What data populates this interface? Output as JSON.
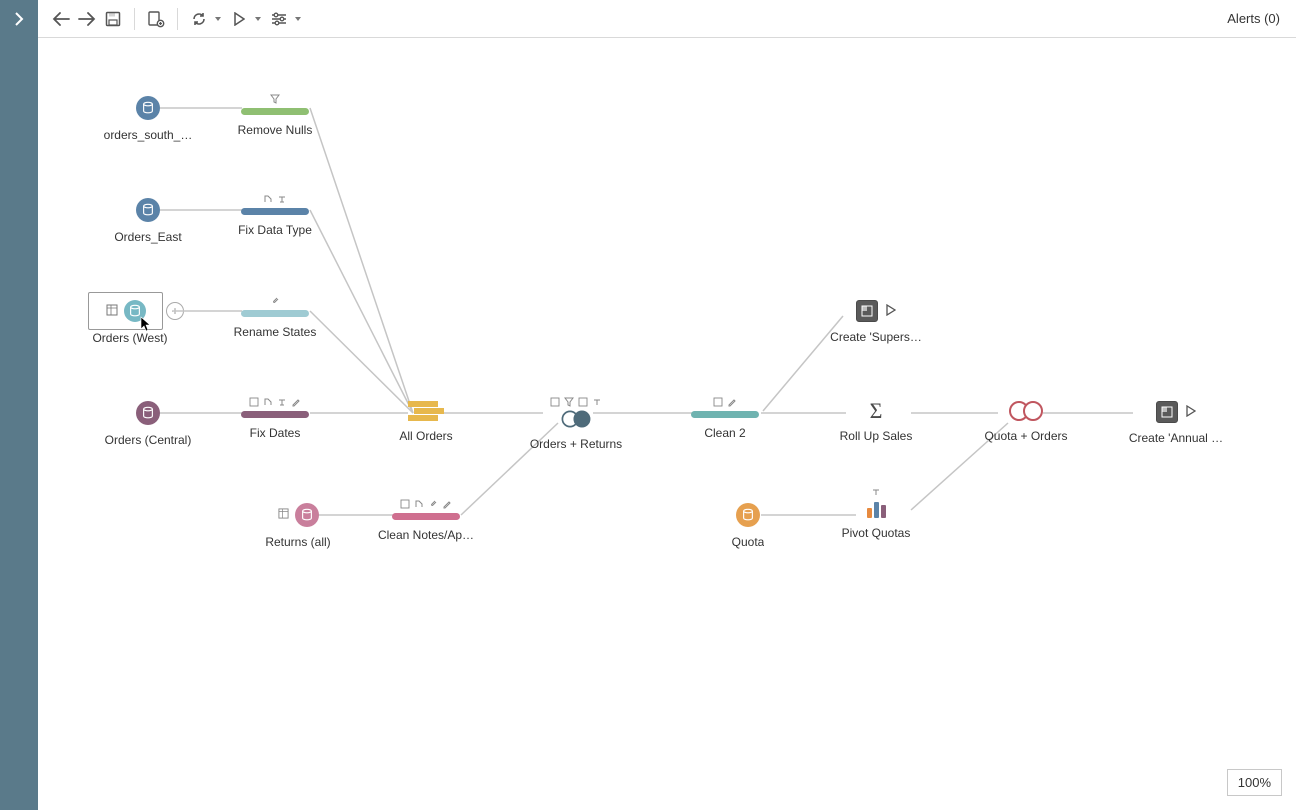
{
  "toolbar": {
    "alerts_label": "Alerts (0)"
  },
  "zoom": {
    "level": "100%"
  },
  "nodes": {
    "orders_south": {
      "label": "orders_south_…"
    },
    "orders_east": {
      "label": "Orders_East"
    },
    "orders_west": {
      "label": "Orders (West)"
    },
    "orders_central": {
      "label": "Orders (Central)"
    },
    "returns_all": {
      "label": "Returns (all)"
    },
    "quota": {
      "label": "Quota"
    },
    "remove_nulls": {
      "label": "Remove Nulls"
    },
    "fix_data_type": {
      "label": "Fix Data Type"
    },
    "rename_states": {
      "label": "Rename States"
    },
    "fix_dates": {
      "label": "Fix Dates"
    },
    "clean_notes": {
      "label": "Clean Notes/Ap…"
    },
    "all_orders": {
      "label": "All Orders"
    },
    "orders_returns": {
      "label": "Orders + Returns"
    },
    "clean2": {
      "label": "Clean 2"
    },
    "rollup_sales": {
      "label": "Roll Up Sales"
    },
    "pivot_quotas": {
      "label": "Pivot Quotas"
    },
    "quota_orders": {
      "label": "Quota + Orders"
    },
    "create_supers": {
      "label": "Create 'Supers…"
    },
    "create_annual": {
      "label": "Create 'Annual …"
    }
  }
}
